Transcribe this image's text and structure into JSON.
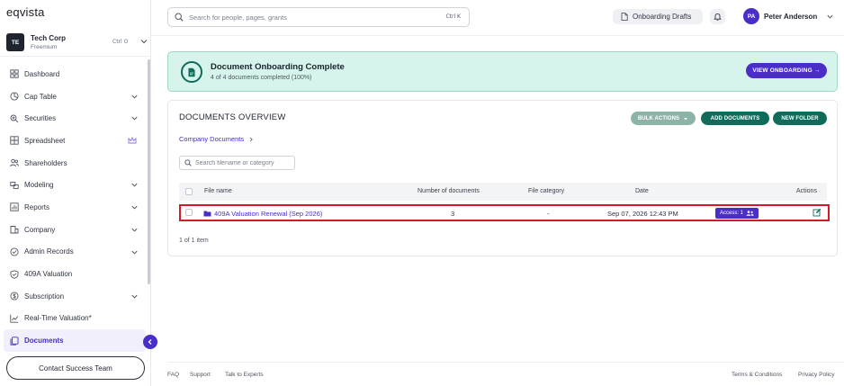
{
  "brand": {
    "logo": "eqvista"
  },
  "company": {
    "initials": "TE",
    "name": "Tech Corp",
    "plan": "Freemium",
    "shortcut": "Ctrl O"
  },
  "sidebar": {
    "items": [
      {
        "label": "Dashboard",
        "icon": "dashboard-icon",
        "chevron": false
      },
      {
        "label": "Cap Table",
        "icon": "pie-chart-icon",
        "chevron": true
      },
      {
        "label": "Securities",
        "icon": "securities-icon",
        "chevron": true
      },
      {
        "label": "Spreadsheet",
        "icon": "spreadsheet-icon",
        "chevron": false,
        "premium": true
      },
      {
        "label": "Shareholders",
        "icon": "users-icon",
        "chevron": false
      },
      {
        "label": "Modeling",
        "icon": "modeling-icon",
        "chevron": true
      },
      {
        "label": "Reports",
        "icon": "reports-icon",
        "chevron": true
      },
      {
        "label": "Company",
        "icon": "company-icon",
        "chevron": true
      },
      {
        "label": "Admin Records",
        "icon": "admin-records-icon",
        "chevron": true
      },
      {
        "label": "409A Valuation",
        "icon": "shield-check-icon",
        "chevron": false
      },
      {
        "label": "Subscription",
        "icon": "subscription-icon",
        "chevron": true
      },
      {
        "label": "Real-Time Valuation*",
        "icon": "trend-line-icon",
        "chevron": false
      },
      {
        "label": "Documents",
        "icon": "documents-icon",
        "chevron": false,
        "active": true
      }
    ],
    "contact_label": "Contact Success Team"
  },
  "header": {
    "search_placeholder": "Search for people, pages, grants",
    "search_shortcut": "Ctrl K",
    "drafts_label": "Onboarding Drafts",
    "user_initials": "PA",
    "user_name": "Peter Anderson"
  },
  "banner": {
    "title": "Document Onboarding Complete",
    "subtitle": "4 of 4 documents completed (100%)",
    "button_label": "VIEW ONBOARDING →"
  },
  "documents": {
    "title": "DOCUMENTS OVERVIEW",
    "bulk_label": "BULK ACTIONS",
    "add_label": "ADD DOCUMENTS",
    "new_folder_label": "NEW FOLDER",
    "breadcrumb": "Company Documents",
    "filter_placeholder": "Search filename or category",
    "columns": {
      "file_name": "File name",
      "count": "Number of documents",
      "category": "File category",
      "date": "Date",
      "actions": "Actions"
    },
    "rows": [
      {
        "file_name": "409A Valuation Renewal (Sep 2026)",
        "count": "3",
        "category": "-",
        "date": "Sep 07, 2026 12:43 PM",
        "access": "Access: 1"
      }
    ],
    "pager": "1 of 1 item"
  },
  "footer": {
    "faq": "FAQ",
    "support": "Support",
    "experts": "Talk to Experts",
    "terms": "Terms & Conditions",
    "privacy": "Privacy Policy"
  },
  "colors": {
    "accent": "#4a2ec7",
    "teal": "#0f6b5a",
    "banner_bg": "#d6f3ec",
    "highlight": "#d31a2b"
  }
}
